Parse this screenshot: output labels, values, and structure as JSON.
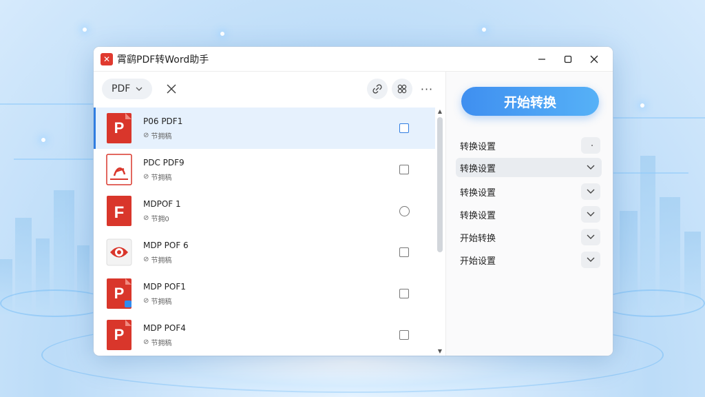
{
  "app": {
    "title": "霄鹞PDF转Word助手",
    "logo_glyph": "✕"
  },
  "toolbar": {
    "format_label": "PDF",
    "more_label": "···"
  },
  "files": [
    {
      "name": "P06 PDF1",
      "sub": "节拥稿",
      "icon": "pdf-p-icon",
      "check": "checked"
    },
    {
      "name": "PDC PDF9",
      "sub": "节拥稿",
      "icon": "pdf-document-icon",
      "check": "square"
    },
    {
      "name": "MDPOF 1",
      "sub": "节拥0",
      "icon": "pdf-f-icon",
      "check": "circle"
    },
    {
      "name": "MDP POF 6",
      "sub": "节拥稿",
      "icon": "pdf-eye-icon",
      "check": "square"
    },
    {
      "name": "MDP POF1",
      "sub": "节拥稿",
      "icon": "pdf-p-icon",
      "check": "square"
    },
    {
      "name": "MDP POF4",
      "sub": "节拥稿",
      "icon": "pdf-p-icon",
      "check": "square"
    }
  ],
  "start_button": {
    "label": "开始转换"
  },
  "settings": [
    {
      "label": "转换设置",
      "active": false
    },
    {
      "label": "转换设置",
      "active": true
    },
    {
      "label": "转换设置",
      "active": false
    },
    {
      "label": "转换设置",
      "active": false
    },
    {
      "label": "开始转换",
      "active": false
    },
    {
      "label": "开始设置",
      "active": false
    }
  ],
  "colors": {
    "accent": "#2f7de1",
    "pdf_red": "#d9362b",
    "start_gradient_from": "#3f8ff0",
    "start_gradient_to": "#56b1f7"
  }
}
